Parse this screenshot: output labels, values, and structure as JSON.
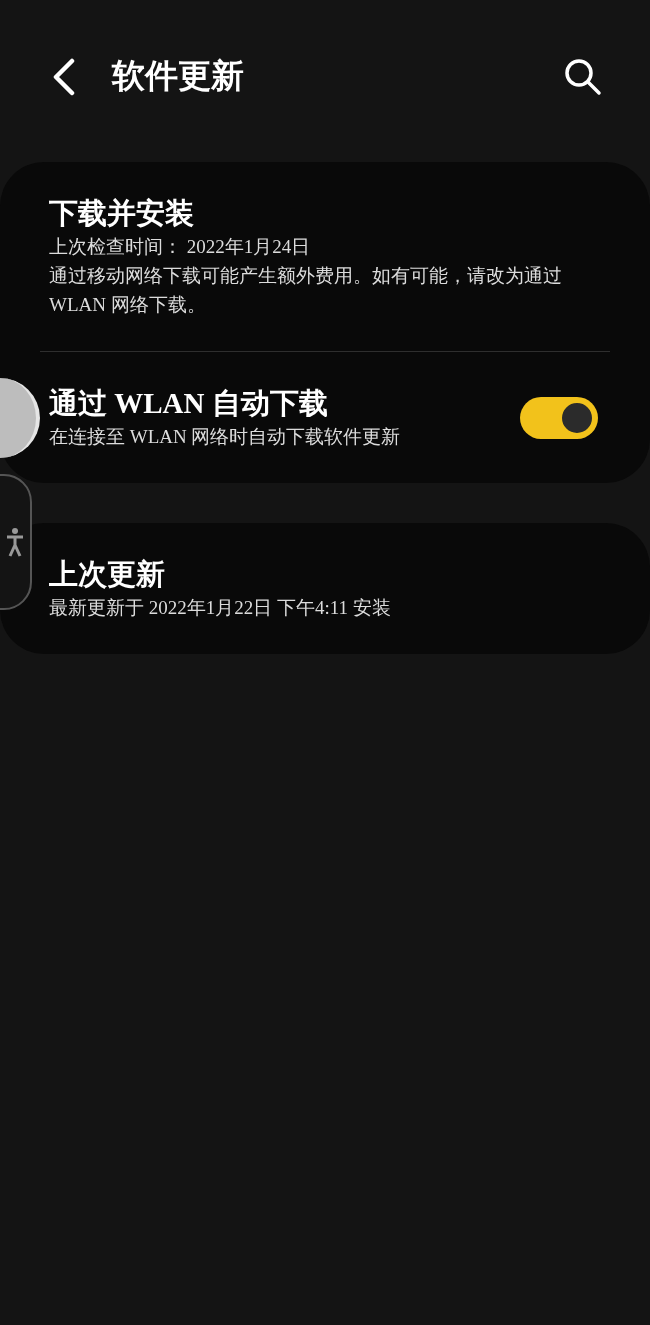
{
  "header": {
    "title": "软件更新"
  },
  "sections": [
    {
      "rows": [
        {
          "kind": "info",
          "title": "下载并安装",
          "lines": [
            "上次检查时间： 2022年1月24日",
            "通过移动网络下载可能产生额外费用。如有可能，请改为通过 WLAN 网络下载。"
          ]
        },
        {
          "kind": "switch",
          "title": "通过 WLAN 自动下载",
          "lines": [
            "在连接至 WLAN 网络时自动下载软件更新"
          ],
          "on": true
        }
      ]
    },
    {
      "rows": [
        {
          "kind": "info",
          "title": "上次更新",
          "lines": [
            "最新更新于 2022年1月22日 下午4:11 安装"
          ]
        }
      ]
    }
  ]
}
